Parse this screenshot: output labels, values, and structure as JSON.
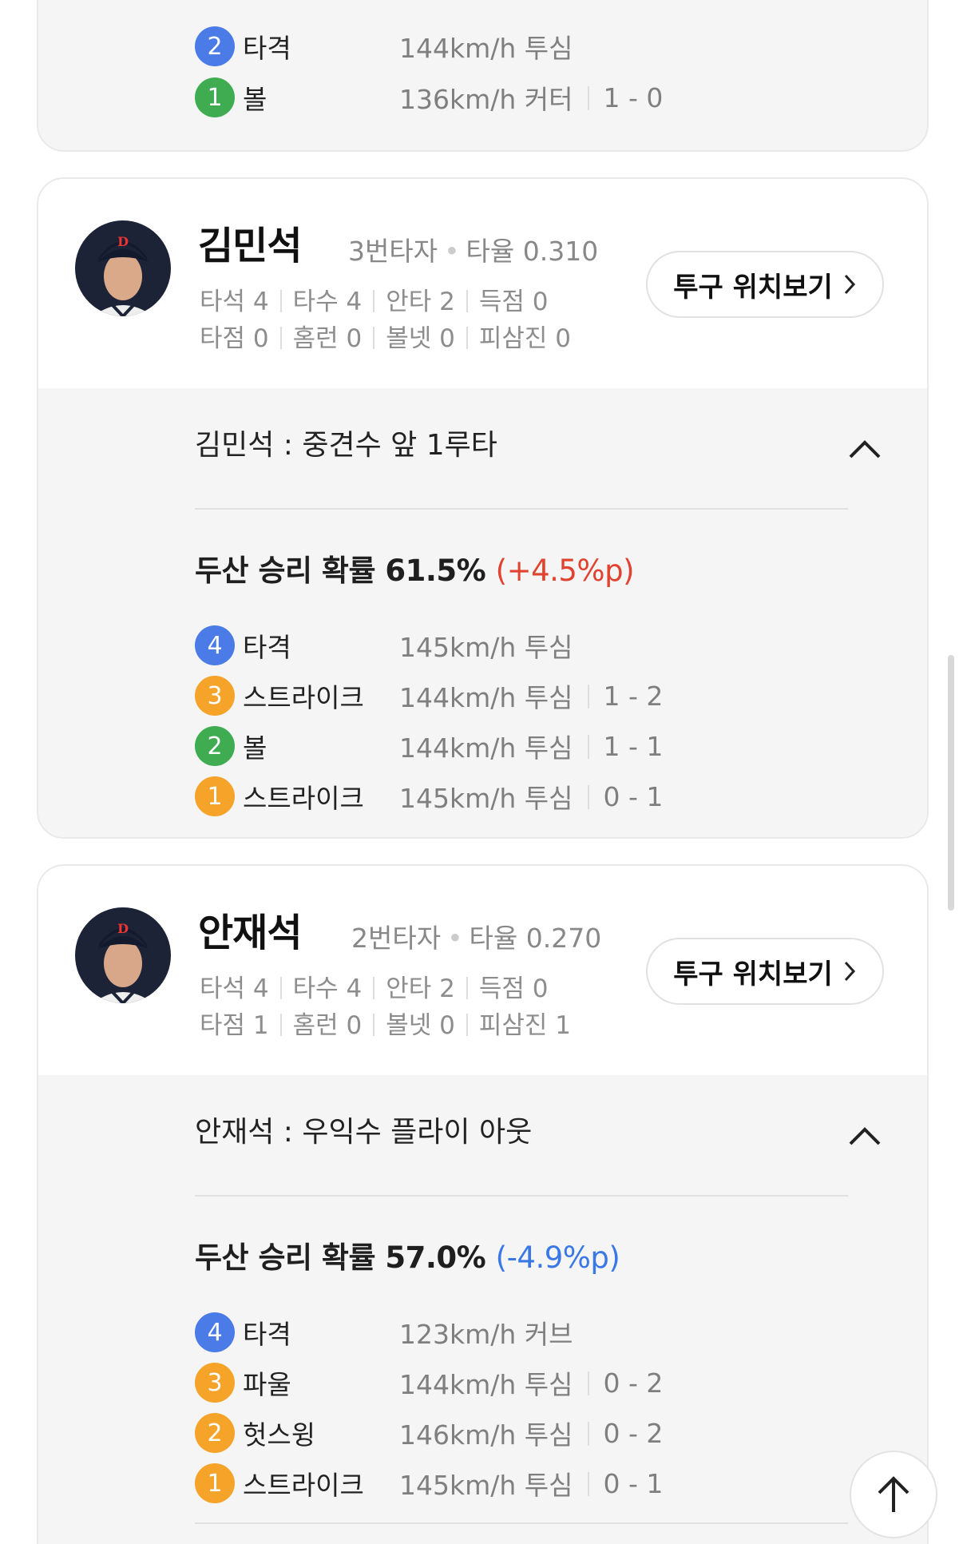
{
  "top_card": {
    "pitches": [
      {
        "num": "2",
        "color": "#3fac52",
        "type": "타격",
        "speed": "144km/h 투심",
        "count": ""
      },
      {
        "num": "1",
        "color": "#3fac52",
        "type": "볼",
        "speed": "136km/h 커터",
        "count": "1 - 0"
      }
    ]
  },
  "batters": [
    {
      "name": "김민석",
      "order": "3번타자",
      "avg": "타율 0.310",
      "stats_row1": [
        "타석 4",
        "타수 4",
        "안타 2",
        "득점 0"
      ],
      "stats_row2": [
        "타점 0",
        "홈런 0",
        "볼넷 0",
        "피삼진 0"
      ],
      "pitch_button": "투구 위치보기",
      "result": "김민석 : 중견수 앞 1루타",
      "win_prob": "두산 승리 확률 61.5%",
      "win_delta": "(+4.5%p)",
      "pitches": [
        {
          "num": "4",
          "type": "타격",
          "speed": "145km/h 투심",
          "count": ""
        },
        {
          "num": "3",
          "type": "스트라이크",
          "speed": "144km/h 투심",
          "count": "1 - 2"
        },
        {
          "num": "2",
          "type": "볼",
          "speed": "144km/h 투심",
          "count": "1 - 1"
        },
        {
          "num": "1",
          "type": "스트라이크",
          "speed": "145km/h 투심",
          "count": "0 - 1"
        }
      ]
    },
    {
      "name": "안재석",
      "order": "2번타자",
      "avg": "타율 0.270",
      "stats_row1": [
        "타석 4",
        "타수 4",
        "안타 2",
        "득점 0"
      ],
      "stats_row2": [
        "타점 1",
        "홈런 0",
        "볼넷 0",
        "피삼진 1"
      ],
      "pitch_button": "투구 위치보기",
      "result": "안재석 : 우익수 플라이 아웃",
      "win_prob": "두산 승리 확률 57.0%",
      "win_delta": "(-4.9%p)",
      "pitches": [
        {
          "num": "4",
          "type": "타격",
          "speed": "123km/h 커브",
          "count": ""
        },
        {
          "num": "3",
          "type": "파울",
          "speed": "144km/h 투심",
          "count": "0 - 2"
        },
        {
          "num": "2",
          "type": "헛스윙",
          "speed": "146km/h 투심",
          "count": "0 - 2"
        },
        {
          "num": "1",
          "type": "스트라이크",
          "speed": "145km/h 투심",
          "count": "0 - 1"
        }
      ]
    }
  ],
  "colors": {
    "hit": "#4a7be6",
    "ball": "#3fac52",
    "strike": "#f5a329",
    "delta_up": "#e0432f",
    "delta_down": "#3a78e6"
  },
  "icons": {
    "expand": "chevron-up-icon",
    "go_top": "arrow-up-icon",
    "button_arrow": "chevron-right-icon"
  }
}
